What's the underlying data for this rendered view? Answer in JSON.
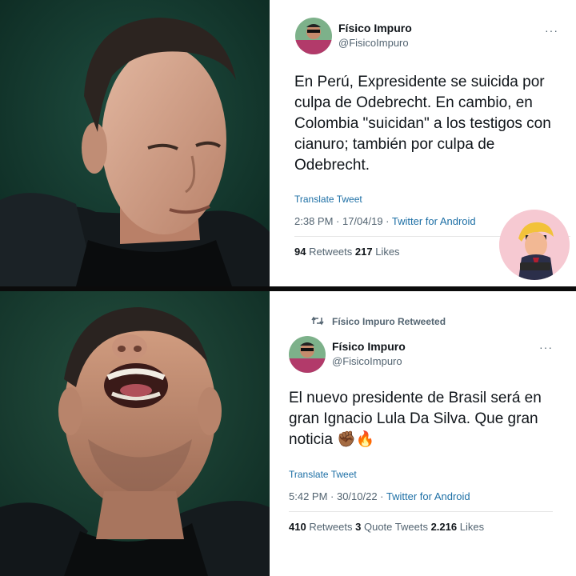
{
  "top_tweet": {
    "name": "Físico Impuro",
    "handle": "@FisicoImpuro",
    "more": "···",
    "text": "En Perú, Expresidente se suicida por culpa de Odebrecht. En cambio, en Colombia \"suicidan\" a los testigos con cianuro; también por culpa de Odebrecht.",
    "translate": "Translate Tweet",
    "time": "2:38 PM · 17/04/19 · ",
    "source": "Twitter for Android",
    "retweets_num": "94",
    "retweets_label": " Retweets ",
    "likes_num": "217",
    "likes_label": " Likes"
  },
  "bottom_tweet": {
    "retweeted_by": "Físico Impuro Retweeted",
    "name": "Físico Impuro",
    "handle": "@FisicoImpuro",
    "more": "···",
    "text": "El nuevo presidente de Brasil será en gran Ignacio Lula Da Silva. Que gran noticia ✊🏾🔥",
    "translate": "Translate Tweet",
    "time": "5:42 PM · 30/10/22 · ",
    "source": "Twitter for Android",
    "retweets_num": "410",
    "retweets_label": " Retweets ",
    "quotes_num": "3",
    "quotes_label": " Quote Tweets ",
    "likes_num": "2.216",
    "likes_label": " Likes"
  },
  "colors": {
    "link": "#1d6fa5",
    "secondary": "#536471",
    "photo_bg": "#143a2f"
  },
  "icons": [
    "retweet-icon",
    "more-icon"
  ]
}
